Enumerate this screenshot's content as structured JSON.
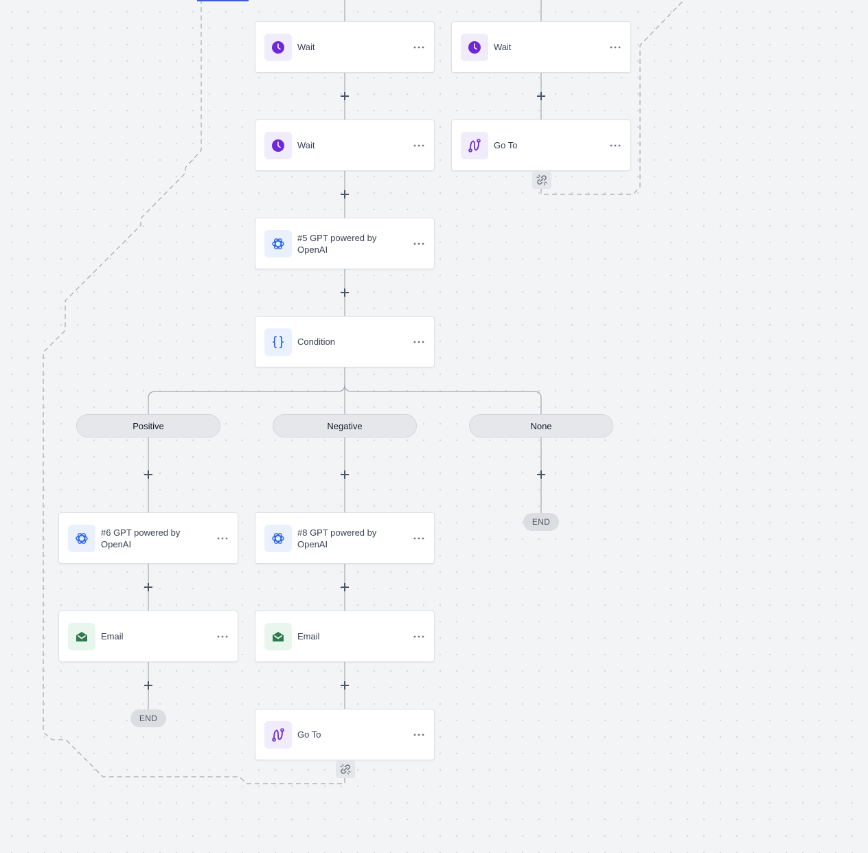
{
  "nodes": {
    "wait_1": {
      "label": "Wait",
      "icon": "clock-icon"
    },
    "wait_right": {
      "label": "Wait",
      "icon": "clock-icon"
    },
    "wait_2": {
      "label": "Wait",
      "icon": "clock-icon"
    },
    "goto_right": {
      "label": "Go To",
      "icon": "route-icon"
    },
    "gpt_5": {
      "label": "#5 GPT powered by OpenAI",
      "icon": "openai-icon"
    },
    "condition": {
      "label": "Condition",
      "icon": "braces-icon"
    },
    "gpt_6": {
      "label": "#6 GPT powered by OpenAI",
      "icon": "openai-icon"
    },
    "gpt_8": {
      "label": "#8 GPT powered by OpenAI",
      "icon": "openai-icon"
    },
    "email_positive": {
      "label": "Email",
      "icon": "envelope-open-icon"
    },
    "email_negative": {
      "label": "Email",
      "icon": "envelope-open-icon"
    },
    "goto_bottom": {
      "label": "Go To",
      "icon": "route-icon"
    }
  },
  "branches": {
    "positive": "Positive",
    "negative": "Negative",
    "none": "None"
  },
  "end_labels": {
    "none": "END",
    "positive": "END"
  },
  "colors": {
    "purple_accent": "#6d28d9",
    "blue_accent": "#2563eb",
    "green_accent": "#2f7a4f",
    "connector": "#9ca3af"
  }
}
